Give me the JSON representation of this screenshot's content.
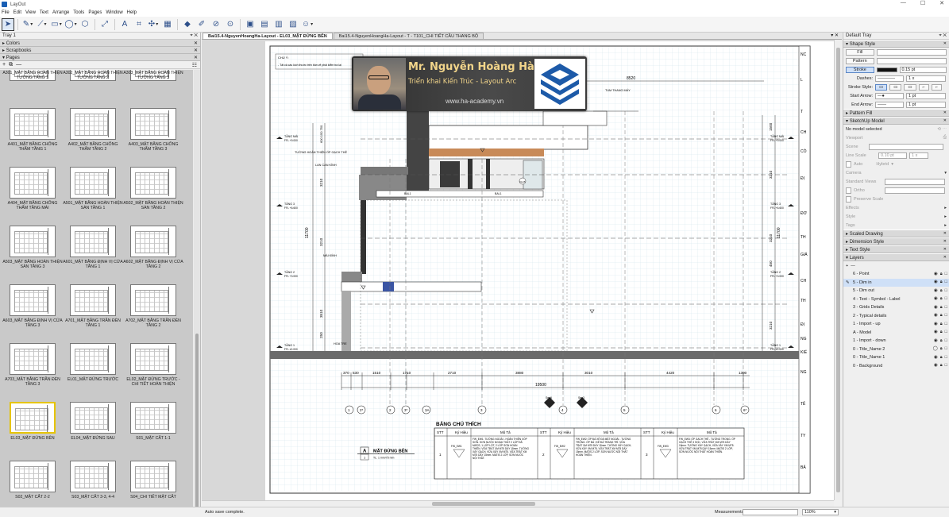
{
  "window": {
    "title": "LayOut",
    "controls": [
      "—",
      "☐",
      "✕"
    ]
  },
  "menu": [
    "File",
    "Edit",
    "View",
    "Text",
    "Arrange",
    "Tools",
    "Pages",
    "Window",
    "Help"
  ],
  "toolbar": {
    "icons": [
      "select-icon",
      "pencil-icon",
      "line-icon",
      "rectangle-icon",
      "circle-icon",
      "polygon-icon",
      "erase-icon",
      "style-icon",
      "split-icon",
      "join-icon",
      "text-icon",
      "table-icon",
      "eraser-icon",
      "sample-icon",
      "paint-icon",
      "dimension-icon",
      "screen-icon",
      "doc-icon",
      "doc2-icon",
      "page-icon",
      "user-icon"
    ]
  },
  "left_tray": {
    "title": "Tray 1",
    "panels": {
      "colors": "Colors",
      "scrapbooks": "Scrapbooks",
      "pages": "Pages"
    },
    "pages_tools": {
      "add": "+",
      "dup": "⧉",
      "remove": "—",
      "view": "☷"
    },
    "pages": [
      "A301_MẶT BẰNG HOÀN THIỆN TƯỜNG TẦNG 1",
      "A302_MẶT BẰNG HOÀN THIỆN TƯỜNG TẦNG 2",
      "A303_MẶT BẰNG HOÀN THIỆN TƯỜNG TẦNG 3",
      "A401_MẶT BẰNG CHỐNG THẤM TẦNG 1",
      "A402_MẶT BẰNG CHỐNG THẤM TẦNG 2",
      "A403_MẶT BẰNG CHỐNG THẤM TẦNG 3",
      "A404_MẶT BẰNG CHỐNG THẤM TẦNG MÁI",
      "A501_MẶT BẰNG HOÀN THIỆN SÀN TẦNG 1",
      "A502_MẶT BẰNG HOÀN THIỆN SÀN TẦNG 2",
      "A503_MẶT BẰNG HOÀN THIỆN SÀN TẦNG 3",
      "A601_MẶT BẰNG ĐỊNH VỊ CỬA TẦNG 1",
      "A602_MẶT BẰNG ĐỊNH VỊ CỬA TẦNG 2",
      "A603_MẶT BẰNG ĐỊNH VỊ CỬA TẦNG 3",
      "A701_MẶT BẰNG TRẦN ĐÈN TẦNG 1",
      "A702_MẶT BẰNG TRẦN ĐÈN TẦNG 2",
      "A703_MẶT BẰNG TRẦN ĐÈN TẦNG 3",
      "EL01_MẶT ĐỨNG TRƯỚC",
      "EL02_MẶT ĐỨNG TRƯỚC - CHI TIẾT HOÀN THIỆN",
      "EL03_MẶT ĐỨNG BÊN",
      "EL04_MẶT ĐỨNG SAU",
      "S01_MẶT CẮT 1-1",
      "S02_MẶT CẮT 2-2",
      "S03_MẶT CẮT 3-3, 4-4",
      "S04_CHI TIẾT MẶT CẮT"
    ],
    "selected_page": "EL03_MẶT ĐỨNG BÊN"
  },
  "doc_tabs": [
    "Bai15.4-NguyenHoangHa-Layout - EL03_MẶT ĐỨNG BÊN",
    "Bai15.4-NguyenHoangHa-Layout - T - T101_CHI TIẾT CẦU THANG BỘ"
  ],
  "drawing": {
    "note_title": "CHÚ Ý:",
    "note_text": "- Tất cả các kích thước trên bản vẽ phải kiểm tra lại",
    "dims_top": [
      "8520"
    ],
    "dims_bottom": [
      "370",
      "530",
      "1510",
      "1710",
      "2710",
      "3880",
      "3010",
      "4420",
      "1300"
    ],
    "total": "19500",
    "dims_left": [
      "3210",
      "3210",
      "3510",
      "250"
    ],
    "dims_left_top": "600 150 750",
    "dims_right": [
      "1500",
      "3210",
      "3210",
      "3210",
      "450"
    ],
    "dim_11700": "11700",
    "levels": [
      {
        "label": "TẦNG MÁI",
        "value": "FFL +9.000"
      },
      {
        "label": "TẦNG 3",
        "value": "FFL +6.600"
      },
      {
        "label": "TẦNG 2",
        "value": "FFL +3.000"
      },
      {
        "label": "TẦNG 1",
        "value": "FFL ±0.000"
      }
    ],
    "labels": {
      "tum": "TUM THANG MÁY",
      "wall": "TƯỜNG HOÀN THIỆN ỐP GẠCH THẺ",
      "rail": "LAN CAN KÍNH",
      "glass": "MÁI KÍNH",
      "hoa": "HOA TRE",
      "b1": "BAL1",
      "b2": "BAL1",
      "ch": "CH-B"
    },
    "grids": [
      "1",
      "2*",
      "2",
      "3*",
      "3A",
      "3",
      "4",
      "5",
      "6",
      "6*"
    ],
    "sections": [
      "Sec6",
      "Sec3"
    ],
    "title_block": {
      "letter": "A",
      "name": "MẶT ĐỨNG BÊN",
      "num": "1",
      "scale": "TL: 1 mm/75 mm"
    },
    "legend": {
      "title": "BẢNG CHÚ THÍCH",
      "headers": [
        "STT",
        "Ký Hiệu",
        "Mô Tả"
      ],
      "rows": [
        {
          "stt": "1",
          "sym": "FW_EW1",
          "desc": "FW_EW1: TƯỜNG NGOÀI - HOÀN THIỆN XỐP SƠN. SƠN NƯỚC NGOẠI THẤT 2 LỚP ĐÃ MATIS, 1 LỚP LÓT, 2 LỚP SƠN HOÀN THIỆN. VỮA TRÁT XM M75 DÀY 15mm. TƯỜNG XÂY GẠCH, VỮA XÂY XM M75. VỮA TRÁT XM M75 DÀY 15mm. MATIS 2 LỚP, SƠN NƯỚC NỘI THẤT."
        },
        {
          "stt": "2",
          "sym": "FW_EW2",
          "desc": "FW_EW2: ỐP ĐÁ XẺ ĐÁ MẶT NGOÀI - TƯỜNG TRONG. ỐP ĐÁ / KẺ ĐÁ TRANG TRÍ. VỮA TRÁT XM M75 DÀY 15mm. TƯỜNG XÂY GẠCH, VỮA XÂY XM M75. VỮA TRÁT XM M75 DÀY 15mm. MATIS 2 LỚP, SƠN NƯỚC NỘI THẤT HOÀN THIỆN."
        },
        {
          "stt": "3",
          "sym": "FW_EW3",
          "desc": "FW_EW3: ỐP GẠCH THẺ - TƯỜNG TRONG. ỐP GẠCH THẺ 3 SỌC. VỮA TRÁT XM M75 DÀY 15mm. TƯỜNG XÂY GẠCH, VỮA XÂY XM M75. VỮA TRÁT XM M75 DÀY 15mm. MATIS 2 LỚP, SƠN NƯỚC NỘI THẤT HOÀN THIỆN."
        }
      ]
    },
    "sheet_side": [
      "NC",
      "L",
      "T",
      "CH",
      "CÓ",
      "ĐỊ",
      "ĐƠ",
      "TH",
      "GIÁ",
      "CH",
      "TH",
      "ĐỊ",
      "NG",
      "KIỂ",
      "NG",
      "TÊ",
      "TY",
      "BẢ"
    ]
  },
  "banner": {
    "name": "Mr. Nguyễn Hoàng Hà",
    "sub": "Triển khai Kiến Trúc - Layout Arc",
    "web": "www.ha-academy.vn"
  },
  "right_tray": {
    "title": "Default Tray",
    "shape_style": {
      "head": "Shape Style",
      "fill": "Fill",
      "pattern": "Pattern",
      "stroke": "Stroke",
      "stroke_w": "0.15 pt",
      "dashes": "Dashes:",
      "dash_scale": "1 x",
      "stroke_style": "Stroke Style:",
      "start_arrow": "Start Arrow:",
      "end_arrow": "End Arrow:",
      "arrow_size": "1 pt"
    },
    "pattern_fill": "Pattern Fill",
    "sketchup": {
      "head": "SketchUp Model",
      "none": "No model selected",
      "viewport": "Viewport",
      "scene": "Scene",
      "line_scale": "Line Scale",
      "line_scale_v": "0.10 pt",
      "ls_x": "1 x",
      "auto": "Auto",
      "hybrid": "Hybrid",
      "camera": "Camera",
      "std_views": "Standard Views",
      "ortho": "Ortho",
      "preserve": "Preserve Scale",
      "effects": "Effects",
      "style": "Style",
      "tags": "Tags"
    },
    "scaled": "Scaled Drawing",
    "dimension": "Dimension Style",
    "text_style": "Text Style",
    "layers_head": "Layers",
    "layers": [
      "6 - Point",
      "5 - Dim in",
      "5 - Dim out",
      "4 - Text - Symbol - Label",
      "3 - Grids Details",
      "2 - Typical details",
      "1 - Import - up",
      "A - Model",
      "1 - Import - down",
      "0 - Title_Name 2",
      "0 - Title_Name 1",
      "0 - Background"
    ],
    "active_layer": "5 - Dim in"
  },
  "status": {
    "message": "Auto save complete.",
    "measurements": "Measurements",
    "zoom": "110%"
  }
}
